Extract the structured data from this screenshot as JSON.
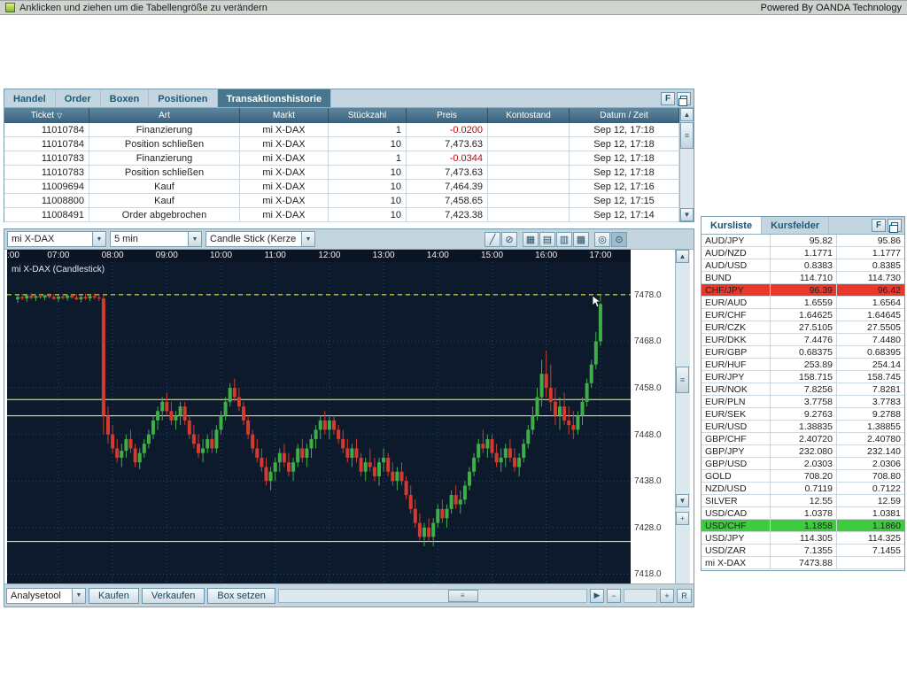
{
  "icons": {
    "up": "▲",
    "down": "▼",
    "right": "▶",
    "dropdown": "▼",
    "filter": "▽",
    "grip": "≡",
    "minus": "−",
    "plus": "+",
    "reset": "R",
    "f": "F",
    "hgrip": "|||"
  },
  "transactions_panel": {
    "tabs": [
      "Handel",
      "Order",
      "Boxen",
      "Positionen",
      "Transaktionshistorie"
    ],
    "active_tab": "Transaktionshistorie",
    "columns": [
      "Ticket",
      "Art",
      "Markt",
      "Stückzahl",
      "Preis",
      "Kontostand",
      "Datum / Zeit"
    ],
    "rows": [
      {
        "ticket": "11010784",
        "art": "Finanzierung",
        "markt": "mi X-DAX",
        "stueckzahl": "1",
        "preis": "-0.0200",
        "preis_negativ": true,
        "kontostand": "",
        "datum": "Sep 12, 17:18"
      },
      {
        "ticket": "11010784",
        "art": "Position schließen",
        "markt": "mi X-DAX",
        "stueckzahl": "10",
        "preis": "7,473.63",
        "preis_negativ": false,
        "kontostand": "",
        "datum": "Sep 12, 17:18"
      },
      {
        "ticket": "11010783",
        "art": "Finanzierung",
        "markt": "mi X-DAX",
        "stueckzahl": "1",
        "preis": "-0.0344",
        "preis_negativ": true,
        "kontostand": "",
        "datum": "Sep 12, 17:18"
      },
      {
        "ticket": "11010783",
        "art": "Position schließen",
        "markt": "mi X-DAX",
        "stueckzahl": "10",
        "preis": "7,473.63",
        "preis_negativ": false,
        "kontostand": "",
        "datum": "Sep 12, 17:18"
      },
      {
        "ticket": "11009694",
        "art": "Kauf",
        "markt": "mi X-DAX",
        "stueckzahl": "10",
        "preis": "7,464.39",
        "preis_negativ": false,
        "kontostand": "",
        "datum": "Sep 12, 17:16"
      },
      {
        "ticket": "11008800",
        "art": "Kauf",
        "markt": "mi X-DAX",
        "stueckzahl": "10",
        "preis": "7,458.65",
        "preis_negativ": false,
        "kontostand": "",
        "datum": "Sep 12, 17:15"
      },
      {
        "ticket": "11008491",
        "art": "Order abgebrochen",
        "markt": "mi X-DAX",
        "stueckzahl": "10",
        "preis": "7,423.38",
        "preis_negativ": false,
        "kontostand": "",
        "datum": "Sep 12, 17:14"
      }
    ]
  },
  "chart_panel": {
    "market_select": "mi X-DAX",
    "interval_select": "5 min",
    "type_select": "Candle Stick (Kerze",
    "toolbar_icons": [
      {
        "name": "draw-line-tool",
        "glyph": "╱",
        "sep_before": false,
        "pressed": false
      },
      {
        "name": "erase-drawings-tool",
        "glyph": "⊘",
        "sep_before": false,
        "pressed": false
      },
      {
        "name": "grid-style-1",
        "glyph": "▦",
        "sep_before": true,
        "pressed": false
      },
      {
        "name": "grid-style-2",
        "glyph": "▤",
        "sep_before": false,
        "pressed": false
      },
      {
        "name": "grid-style-3",
        "glyph": "▥",
        "sep_before": false,
        "pressed": false
      },
      {
        "name": "grid-style-4",
        "glyph": "▩",
        "sep_before": false,
        "pressed": false
      },
      {
        "name": "crosshair-toggle",
        "glyph": "◎",
        "sep_before": true,
        "pressed": false
      },
      {
        "name": "pointer-toggle",
        "glyph": "⊙",
        "sep_before": false,
        "pressed": true
      }
    ],
    "bottom": {
      "analysetool": "Analysetool",
      "kaufen": "Kaufen",
      "verkaufen": "Verkaufen",
      "box_setzen": "Box setzen"
    }
  },
  "chart_data": {
    "type": "candlestick",
    "title": "mi X-DAX (Candlestick)",
    "interval": "5 min",
    "start_time": "06:15",
    "xticks": [
      ":00",
      "07:00",
      "08:00",
      "09:00",
      "10:00",
      "11:00",
      "12:00",
      "13:00",
      "14:00",
      "15:00",
      "16:00",
      "17:00"
    ],
    "yticks": [
      7478.0,
      7468.0,
      7458.0,
      7448.0,
      7438.0,
      7428.0,
      7418.0
    ],
    "ylim": [
      7416,
      7485
    ],
    "grid": true,
    "hlines": [
      {
        "price": 7478.0,
        "style": "dashed"
      },
      {
        "price": 7455.5,
        "style": "solid"
      },
      {
        "price": 7452.0,
        "style": "solid"
      },
      {
        "price": 7425.0,
        "style": "solid"
      }
    ],
    "colors": {
      "up": "#3fae49",
      "down": "#d23b2e",
      "line": "#ffff55",
      "bg": "#0d1a2c",
      "grid": "#24406a"
    },
    "candles": [
      [
        7477.0,
        7478.0,
        7476.2,
        7477.5
      ],
      [
        7477.5,
        7478.2,
        7476.8,
        7477.2
      ],
      [
        7477.2,
        7478.0,
        7476.5,
        7477.8
      ],
      [
        7477.8,
        7478.3,
        7477.0,
        7477.3
      ],
      [
        7477.3,
        7478.0,
        7476.6,
        7477.7
      ],
      [
        7477.7,
        7478.2,
        7477.1,
        7477.4
      ],
      [
        7477.4,
        7478.0,
        7476.8,
        7477.9
      ],
      [
        7477.9,
        7478.3,
        7477.2,
        7477.5
      ],
      [
        7477.5,
        7478.1,
        7476.9,
        7477.1
      ],
      [
        7477.1,
        7477.9,
        7476.4,
        7477.6
      ],
      [
        7477.6,
        7478.2,
        7477.0,
        7477.3
      ],
      [
        7477.3,
        7478.0,
        7476.7,
        7477.8
      ],
      [
        7477.8,
        7478.2,
        7477.1,
        7477.4
      ],
      [
        7477.4,
        7478.1,
        7476.8,
        7477.0
      ],
      [
        7477.0,
        7477.8,
        7476.3,
        7477.5
      ],
      [
        7477.5,
        7478.2,
        7476.9,
        7477.2
      ],
      [
        7477.2,
        7478.0,
        7476.6,
        7477.7
      ],
      [
        7477.7,
        7478.3,
        7477.0,
        7477.4
      ],
      [
        7477.4,
        7478.0,
        7476.7,
        7477.2
      ],
      [
        7477.2,
        7477.8,
        7448.0,
        7452.0
      ],
      [
        7452.0,
        7454.0,
        7446.0,
        7448.0
      ],
      [
        7448,
        7450,
        7444,
        7445
      ],
      [
        7445,
        7447,
        7442,
        7443
      ],
      [
        7443,
        7446,
        7441,
        7444.5
      ],
      [
        7444.5,
        7448,
        7443,
        7447
      ],
      [
        7447,
        7449,
        7444,
        7445
      ],
      [
        7445,
        7446,
        7441,
        7442
      ],
      [
        7442,
        7445,
        7440.5,
        7444
      ],
      [
        7444,
        7447,
        7443,
        7446
      ],
      [
        7446,
        7449,
        7445,
        7448
      ],
      [
        7448,
        7452,
        7447,
        7451
      ],
      [
        7451,
        7454,
        7449,
        7453
      ],
      [
        7453,
        7456,
        7451,
        7455
      ],
      [
        7455,
        7457,
        7452,
        7453
      ],
      [
        7453,
        7455,
        7450,
        7451
      ],
      [
        7451,
        7453,
        7449,
        7452
      ],
      [
        7452,
        7455,
        7450,
        7454
      ],
      [
        7454,
        7455,
        7450,
        7451
      ],
      [
        7451,
        7452,
        7447,
        7448
      ],
      [
        7448,
        7450,
        7445,
        7446
      ],
      [
        7446,
        7448,
        7443,
        7444
      ],
      [
        7444,
        7447,
        7442,
        7445
      ],
      [
        7445,
        7448,
        7444,
        7447
      ],
      [
        7447,
        7449,
        7444,
        7445
      ],
      [
        7445,
        7450,
        7444,
        7449
      ],
      [
        7449,
        7453,
        7448,
        7452
      ],
      [
        7452,
        7456,
        7451,
        7455
      ],
      [
        7455,
        7459,
        7454,
        7458
      ],
      [
        7458,
        7460,
        7455,
        7456
      ],
      [
        7456,
        7458,
        7453,
        7454
      ],
      [
        7454,
        7455,
        7450,
        7451
      ],
      [
        7451,
        7452,
        7447,
        7448
      ],
      [
        7448,
        7449,
        7444,
        7445
      ],
      [
        7445,
        7447,
        7442,
        7443
      ],
      [
        7443,
        7445,
        7440,
        7441
      ],
      [
        7441,
        7443,
        7437,
        7438
      ],
      [
        7438,
        7441,
        7436,
        7440
      ],
      [
        7440,
        7443,
        7438,
        7442
      ],
      [
        7442,
        7445,
        7440,
        7444
      ],
      [
        7444,
        7446,
        7441,
        7442
      ],
      [
        7442,
        7444,
        7439,
        7440
      ],
      [
        7440,
        7443,
        7438,
        7442
      ],
      [
        7442,
        7446,
        7441,
        7445
      ],
      [
        7445,
        7447,
        7442,
        7443
      ],
      [
        7443,
        7446,
        7441,
        7445
      ],
      [
        7445,
        7448,
        7443,
        7447
      ],
      [
        7447,
        7450,
        7445,
        7449
      ],
      [
        7449,
        7452,
        7447,
        7451
      ],
      [
        7451,
        7453,
        7448,
        7449
      ],
      [
        7449,
        7452,
        7447,
        7451
      ],
      [
        7451,
        7452,
        7448,
        7449
      ],
      [
        7449,
        7450,
        7446,
        7447
      ],
      [
        7447,
        7449,
        7444,
        7445
      ],
      [
        7445,
        7447,
        7442,
        7443
      ],
      [
        7443,
        7446,
        7441,
        7445
      ],
      [
        7445,
        7447,
        7442,
        7443
      ],
      [
        7443,
        7444,
        7439,
        7440
      ],
      [
        7440,
        7443,
        7438,
        7442
      ],
      [
        7442,
        7445,
        7440,
        7441
      ],
      [
        7441,
        7443,
        7438,
        7439
      ],
      [
        7439,
        7443,
        7437,
        7442
      ],
      [
        7442,
        7445,
        7440,
        7443
      ],
      [
        7443,
        7444,
        7439,
        7440
      ],
      [
        7440,
        7442,
        7437,
        7438
      ],
      [
        7438,
        7441,
        7436,
        7440
      ],
      [
        7440,
        7442,
        7437,
        7438
      ],
      [
        7438,
        7439,
        7434,
        7435
      ],
      [
        7435,
        7437,
        7431,
        7432
      ],
      [
        7432,
        7434,
        7428,
        7429
      ],
      [
        7429,
        7431,
        7425,
        7426
      ],
      [
        7426,
        7429,
        7424,
        7428
      ],
      [
        7428,
        7430,
        7425,
        7426
      ],
      [
        7426,
        7430,
        7424,
        7429
      ],
      [
        7429,
        7433,
        7428,
        7432
      ],
      [
        7432,
        7434,
        7429,
        7430
      ],
      [
        7430,
        7433,
        7428,
        7432
      ],
      [
        7432,
        7436,
        7431,
        7435
      ],
      [
        7435,
        7437,
        7432,
        7433
      ],
      [
        7433,
        7436,
        7431,
        7434
      ],
      [
        7434,
        7438,
        7433,
        7437
      ],
      [
        7437,
        7441,
        7436,
        7440
      ],
      [
        7440,
        7444,
        7439,
        7443
      ],
      [
        7443,
        7447,
        7442,
        7446
      ],
      [
        7446,
        7449,
        7444,
        7445
      ],
      [
        7445,
        7448,
        7443,
        7447
      ],
      [
        7447,
        7448,
        7443,
        7444
      ],
      [
        7444,
        7446,
        7441,
        7442
      ],
      [
        7442,
        7445,
        7440,
        7443
      ],
      [
        7443,
        7446,
        7441,
        7445
      ],
      [
        7445,
        7447,
        7442,
        7443
      ],
      [
        7443,
        7445,
        7440,
        7441
      ],
      [
        7441,
        7444,
        7439,
        7443
      ],
      [
        7443,
        7447,
        7442,
        7446
      ],
      [
        7446,
        7450,
        7445,
        7449
      ],
      [
        7449,
        7454,
        7448,
        7452
      ],
      [
        7452,
        7458,
        7451,
        7456
      ],
      [
        7456,
        7464,
        7454,
        7461
      ],
      [
        7461,
        7466,
        7456,
        7458
      ],
      [
        7458,
        7463,
        7453,
        7455
      ],
      [
        7455,
        7458,
        7450,
        7452
      ],
      [
        7452,
        7456,
        7449,
        7454
      ],
      [
        7454,
        7457,
        7450,
        7451
      ],
      [
        7451,
        7454,
        7448,
        7450
      ],
      [
        7450,
        7453,
        7447,
        7449
      ],
      [
        7449,
        7453,
        7448,
        7452
      ],
      [
        7452,
        7456,
        7450,
        7455
      ],
      [
        7455,
        7460,
        7454,
        7459
      ],
      [
        7459,
        7464,
        7458,
        7463
      ],
      [
        7463,
        7470,
        7462,
        7468
      ],
      [
        7468,
        7478,
        7467,
        7476
      ]
    ]
  },
  "quotes_panel": {
    "tabs": [
      "Kursliste",
      "Kursfelder"
    ],
    "active_tab": "Kursliste",
    "rows": [
      {
        "pair": "AUD/JPY",
        "bid": "95.82",
        "ask": "95.86",
        "highlight": null
      },
      {
        "pair": "AUD/NZD",
        "bid": "1.1771",
        "ask": "1.1777",
        "highlight": null
      },
      {
        "pair": "AUD/USD",
        "bid": "0.8383",
        "ask": "0.8385",
        "highlight": null
      },
      {
        "pair": "BUND",
        "bid": "114.710",
        "ask": "114.730",
        "highlight": null
      },
      {
        "pair": "CHF/JPY",
        "bid": "96.39",
        "ask": "96.42",
        "highlight": "red"
      },
      {
        "pair": "EUR/AUD",
        "bid": "1.6559",
        "ask": "1.6564",
        "highlight": null
      },
      {
        "pair": "EUR/CHF",
        "bid": "1.64625",
        "ask": "1.64645",
        "highlight": null
      },
      {
        "pair": "EUR/CZK",
        "bid": "27.5105",
        "ask": "27.5505",
        "highlight": null
      },
      {
        "pair": "EUR/DKK",
        "bid": "7.4476",
        "ask": "7.4480",
        "highlight": null
      },
      {
        "pair": "EUR/GBP",
        "bid": "0.68375",
        "ask": "0.68395",
        "highlight": null
      },
      {
        "pair": "EUR/HUF",
        "bid": "253.89",
        "ask": "254.14",
        "highlight": null
      },
      {
        "pair": "EUR/JPY",
        "bid": "158.715",
        "ask": "158.745",
        "highlight": null
      },
      {
        "pair": "EUR/NOK",
        "bid": "7.8256",
        "ask": "7.8281",
        "highlight": null
      },
      {
        "pair": "EUR/PLN",
        "bid": "3.7758",
        "ask": "3.7783",
        "highlight": null
      },
      {
        "pair": "EUR/SEK",
        "bid": "9.2763",
        "ask": "9.2788",
        "highlight": null
      },
      {
        "pair": "EUR/USD",
        "bid": "1.38835",
        "ask": "1.38855",
        "highlight": null
      },
      {
        "pair": "GBP/CHF",
        "bid": "2.40720",
        "ask": "2.40780",
        "highlight": null
      },
      {
        "pair": "GBP/JPY",
        "bid": "232.080",
        "ask": "232.140",
        "highlight": null
      },
      {
        "pair": "GBP/USD",
        "bid": "2.0303",
        "ask": "2.0306",
        "highlight": null
      },
      {
        "pair": "GOLD",
        "bid": "708.20",
        "ask": "708.80",
        "highlight": null
      },
      {
        "pair": "NZD/USD",
        "bid": "0.7119",
        "ask": "0.7122",
        "highlight": null
      },
      {
        "pair": "SILVER",
        "bid": "12.55",
        "ask": "12.59",
        "highlight": null
      },
      {
        "pair": "USD/CAD",
        "bid": "1.0378",
        "ask": "1.0381",
        "highlight": null
      },
      {
        "pair": "USD/CHF",
        "bid": "1.1858",
        "ask": "1.1860",
        "highlight": "green"
      },
      {
        "pair": "USD/JPY",
        "bid": "114.305",
        "ask": "114.325",
        "highlight": null
      },
      {
        "pair": "USD/ZAR",
        "bid": "7.1355",
        "ask": "7.1455",
        "highlight": null
      },
      {
        "pair": "mi X-DAX",
        "bid": "7473.88",
        "ask": "",
        "highlight": null
      }
    ]
  },
  "status_bar": {
    "hint": "Anklicken und ziehen um die Tabellengröße zu verändern",
    "powered": "Powered By OANDA Technology"
  }
}
